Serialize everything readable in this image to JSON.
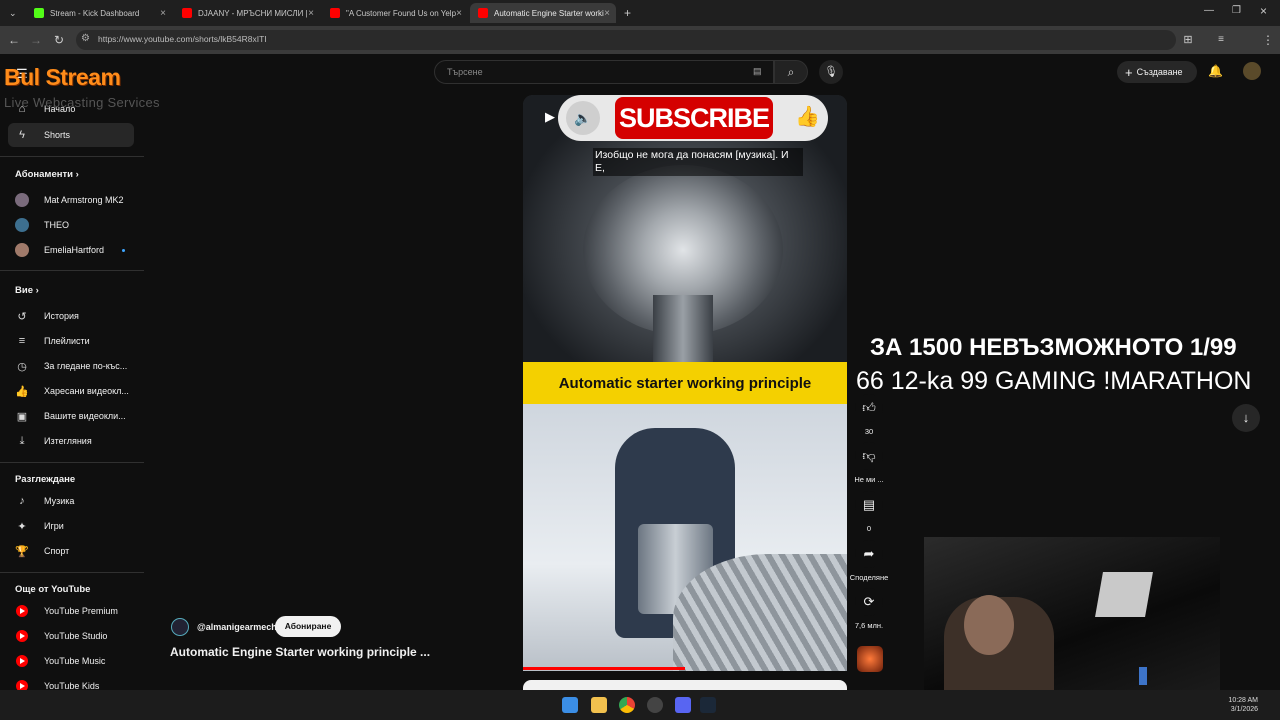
{
  "browser": {
    "tabs": [
      {
        "title": "Stream - Kick Dashboard",
        "color": "#53fc18"
      },
      {
        "title": "DJAANY - МРЪСНИ МИСЛИ |",
        "color": "#ff0000"
      },
      {
        "title": "\"A Customer Found Us on Yelp",
        "color": "#ff0000"
      },
      {
        "title": "Automatic Engine Starter worki",
        "color": "#ff0000"
      }
    ],
    "new_tab": "+",
    "url": "https://www.youtube.com/shorts/lkB54R8xITI"
  },
  "youtube": {
    "search_placeholder": "Търсене",
    "create_label": "Създаване",
    "nav": [
      {
        "label": "Начало",
        "icon": "home-icon"
      },
      {
        "label": "Shorts",
        "icon": "shorts-icon"
      }
    ],
    "subscriptions_title": "Абонаменти",
    "subscriptions": [
      {
        "name": "Mat Armstrong MK2",
        "color": "#7a6b7c"
      },
      {
        "name": "THEO",
        "color": "#3d6f8f"
      },
      {
        "name": "EmeliaHartford",
        "color": "#a07a6a"
      }
    ],
    "you_title": "Вие",
    "you_items": [
      {
        "label": "История",
        "icon": "history-icon"
      },
      {
        "label": "Плейлисти",
        "icon": "playlist-icon"
      },
      {
        "label": "За гледане по-къс...",
        "icon": "clock-icon"
      },
      {
        "label": "Харесани видеокл...",
        "icon": "thumbs-up-icon"
      },
      {
        "label": "Вашите видеокли...",
        "icon": "video-icon"
      },
      {
        "label": "Изтегляния",
        "icon": "download-icon"
      }
    ],
    "explore_title": "Разглеждане",
    "explore_items": [
      {
        "label": "Музика",
        "icon": "music-icon"
      },
      {
        "label": "Игри",
        "icon": "gamepad-icon"
      },
      {
        "label": "Спорт",
        "icon": "trophy-icon"
      }
    ],
    "more_title": "Още от YouTube",
    "more_items": [
      "YouTube Premium",
      "YouTube Studio",
      "YouTube Music",
      "YouTube Kids"
    ],
    "short": {
      "channel": "@almanigearmech",
      "subscribe": "Абониране",
      "title": "Automatic Engine Starter working principle ...",
      "banner": "Automatic starter working principle",
      "caption": "Изобщо не мога да понасям [музика]. И Е,",
      "subscribe_overlay": "SUBSCRIBE",
      "progress": 0.5
    },
    "actions": {
      "likes": "30",
      "dislike": "Не ми ...",
      "comments": "0",
      "share": "Споделяне",
      "remix": "7,6 млн."
    }
  },
  "overlay": {
    "logo": "Bul Stream",
    "logo_tagline": "Live Webcasting Services",
    "line1": "ЗА 1500 НЕВЪЗМОЖНОТО 1/99",
    "line2": "66 12-ka 99 GAMING !MARATHON"
  },
  "taskbar": {
    "time": "10:28 AM",
    "date": "3/1/2026"
  }
}
